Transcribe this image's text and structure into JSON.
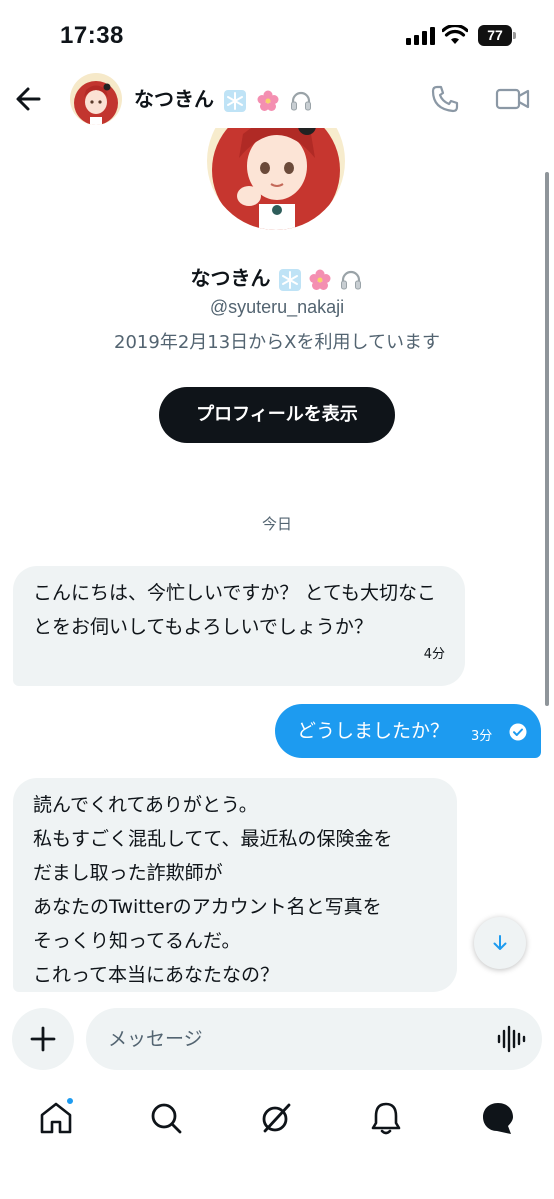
{
  "status_bar": {
    "time": "17:38",
    "battery": "77"
  },
  "header": {
    "name": "なつきん",
    "name_emojis": [
      "snowflake",
      "cherry-blossom",
      "headphones"
    ]
  },
  "profile": {
    "name": "なつきん",
    "handle": "@syuteru_nakaji",
    "joined": "2019年2月13日からXを利用しています",
    "view_profile_label": "プロフィールを表示"
  },
  "conversation": {
    "date_divider": "今日",
    "messages": [
      {
        "direction": "incoming",
        "text": "こんにちは、今忙しいですか？ とても大切なことをお伺いしてもよろしいでしょうか？",
        "time": "4分"
      },
      {
        "direction": "outgoing",
        "text": "どうしましたか？",
        "time": "3分",
        "status": "sent"
      },
      {
        "direction": "incoming",
        "lines": [
          "読んでくれてありがとう。",
          "私もすごく混乱してて、最近私の保険金を",
          "だまし取った詐欺師が",
          "あなたのTwitterのアカウント名と写真を",
          "そっくり知ってるんだ。",
          "これって本当にあなたなの？"
        ]
      }
    ]
  },
  "composer": {
    "placeholder": "メッセージ"
  },
  "bottom_nav": {
    "items": [
      "home-icon",
      "search-icon",
      "grok-icon",
      "bell-icon",
      "messages-icon"
    ],
    "home_has_notification": true
  },
  "colors": {
    "accent": "#1d9bf0",
    "bubble_incoming": "#eff3f4",
    "text": "#0f1419",
    "secondary_text": "#536471",
    "button_dark": "#0f1419"
  }
}
